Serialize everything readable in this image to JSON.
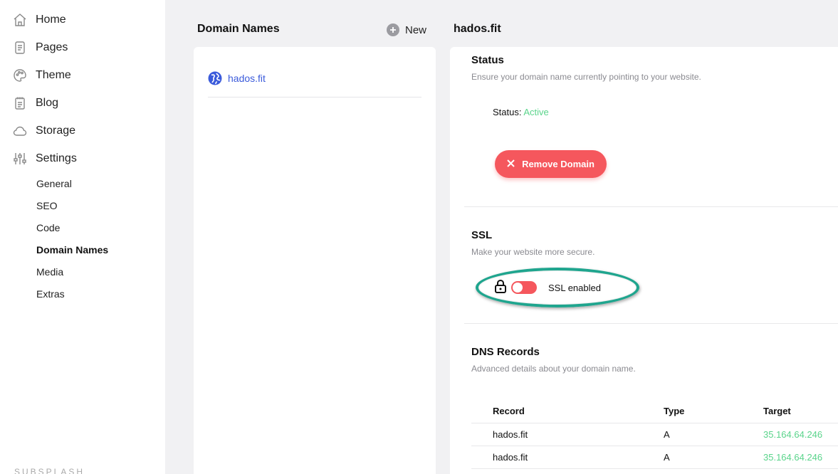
{
  "sidebar": {
    "items": [
      {
        "label": "Home",
        "icon": "home-icon"
      },
      {
        "label": "Pages",
        "icon": "page-icon"
      },
      {
        "label": "Theme",
        "icon": "palette-icon"
      },
      {
        "label": "Blog",
        "icon": "notepad-icon"
      },
      {
        "label": "Storage",
        "icon": "cloud-icon"
      },
      {
        "label": "Settings",
        "icon": "sliders-icon"
      }
    ],
    "subitems": [
      {
        "label": "General"
      },
      {
        "label": "SEO"
      },
      {
        "label": "Code"
      },
      {
        "label": "Domain Names",
        "active": true
      },
      {
        "label": "Media"
      },
      {
        "label": "Extras"
      }
    ],
    "brand": "SUBSPLASH"
  },
  "domain_list": {
    "title": "Domain Names",
    "new_label": "New",
    "domains": [
      {
        "label": "hados.fit",
        "icon": "globe-icon"
      }
    ]
  },
  "details": {
    "title": "hados.fit",
    "status": {
      "title": "Status",
      "description": "Ensure your domain name currently pointing to your website.",
      "status_label": "Status:",
      "status_value": "Active",
      "remove_label": "Remove Domain"
    },
    "ssl": {
      "title": "SSL",
      "description": "Make your website more secure.",
      "toggle_label": "SSL enabled",
      "toggle_on": false
    },
    "dns": {
      "title": "DNS Records",
      "description": "Advanced details about your domain name.",
      "columns": [
        "Record",
        "Type",
        "Target"
      ],
      "rows": [
        {
          "record": "hados.fit",
          "type": "A",
          "target": "35.164.64.246"
        },
        {
          "record": "hados.fit",
          "type": "A",
          "target": "35.164.64.246"
        }
      ]
    }
  },
  "colors": {
    "accent_red": "#f5575d",
    "active_green": "#5ad48b",
    "link_blue": "#3b5bdb",
    "highlight_teal": "#1fa58e"
  }
}
